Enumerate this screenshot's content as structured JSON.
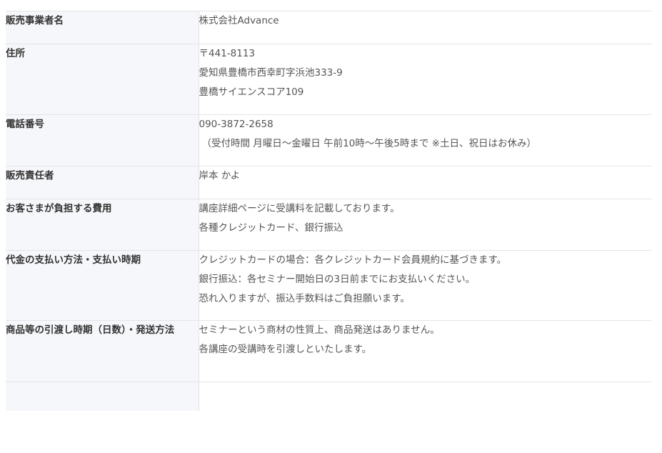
{
  "rows": [
    {
      "label": "販売事業者名",
      "lines": [
        "株式会社Advance"
      ]
    },
    {
      "label": "住所",
      "lines": [
        "〒441-8113",
        "愛知県豊橋市西幸町字浜池333-9",
        "豊橋サイエンスコア109"
      ]
    },
    {
      "label": "電話番号",
      "lines": [
        "090-3872-2658",
        "（受付時間 月曜日～金曜日 午前10時～午後5時まで ※土日、祝日はお休み）"
      ]
    },
    {
      "label": "販売責任者",
      "lines": [
        "岸本 かよ"
      ]
    },
    {
      "label": "お客さまが負担する費用",
      "lines": [
        "講座詳細ページに受講料を記載しております。",
        "各種クレジットカード、銀行振込"
      ]
    },
    {
      "label": "代金の支払い方法・支払い時期",
      "lines": [
        "クレジットカードの場合：各クレジットカード会員規約に基づきます。",
        "銀行振込：各セミナー開始日の3日前までにお支払いください。",
        "恐れ入りますが、振込手数料はご負担願います。"
      ]
    },
    {
      "label": "商品等の引渡し時期（日数）・発送方法",
      "lines": [
        "セミナーという商材の性質上、商品発送はありません。",
        "各講座の受講時を引渡しといたします。"
      ]
    }
  ]
}
